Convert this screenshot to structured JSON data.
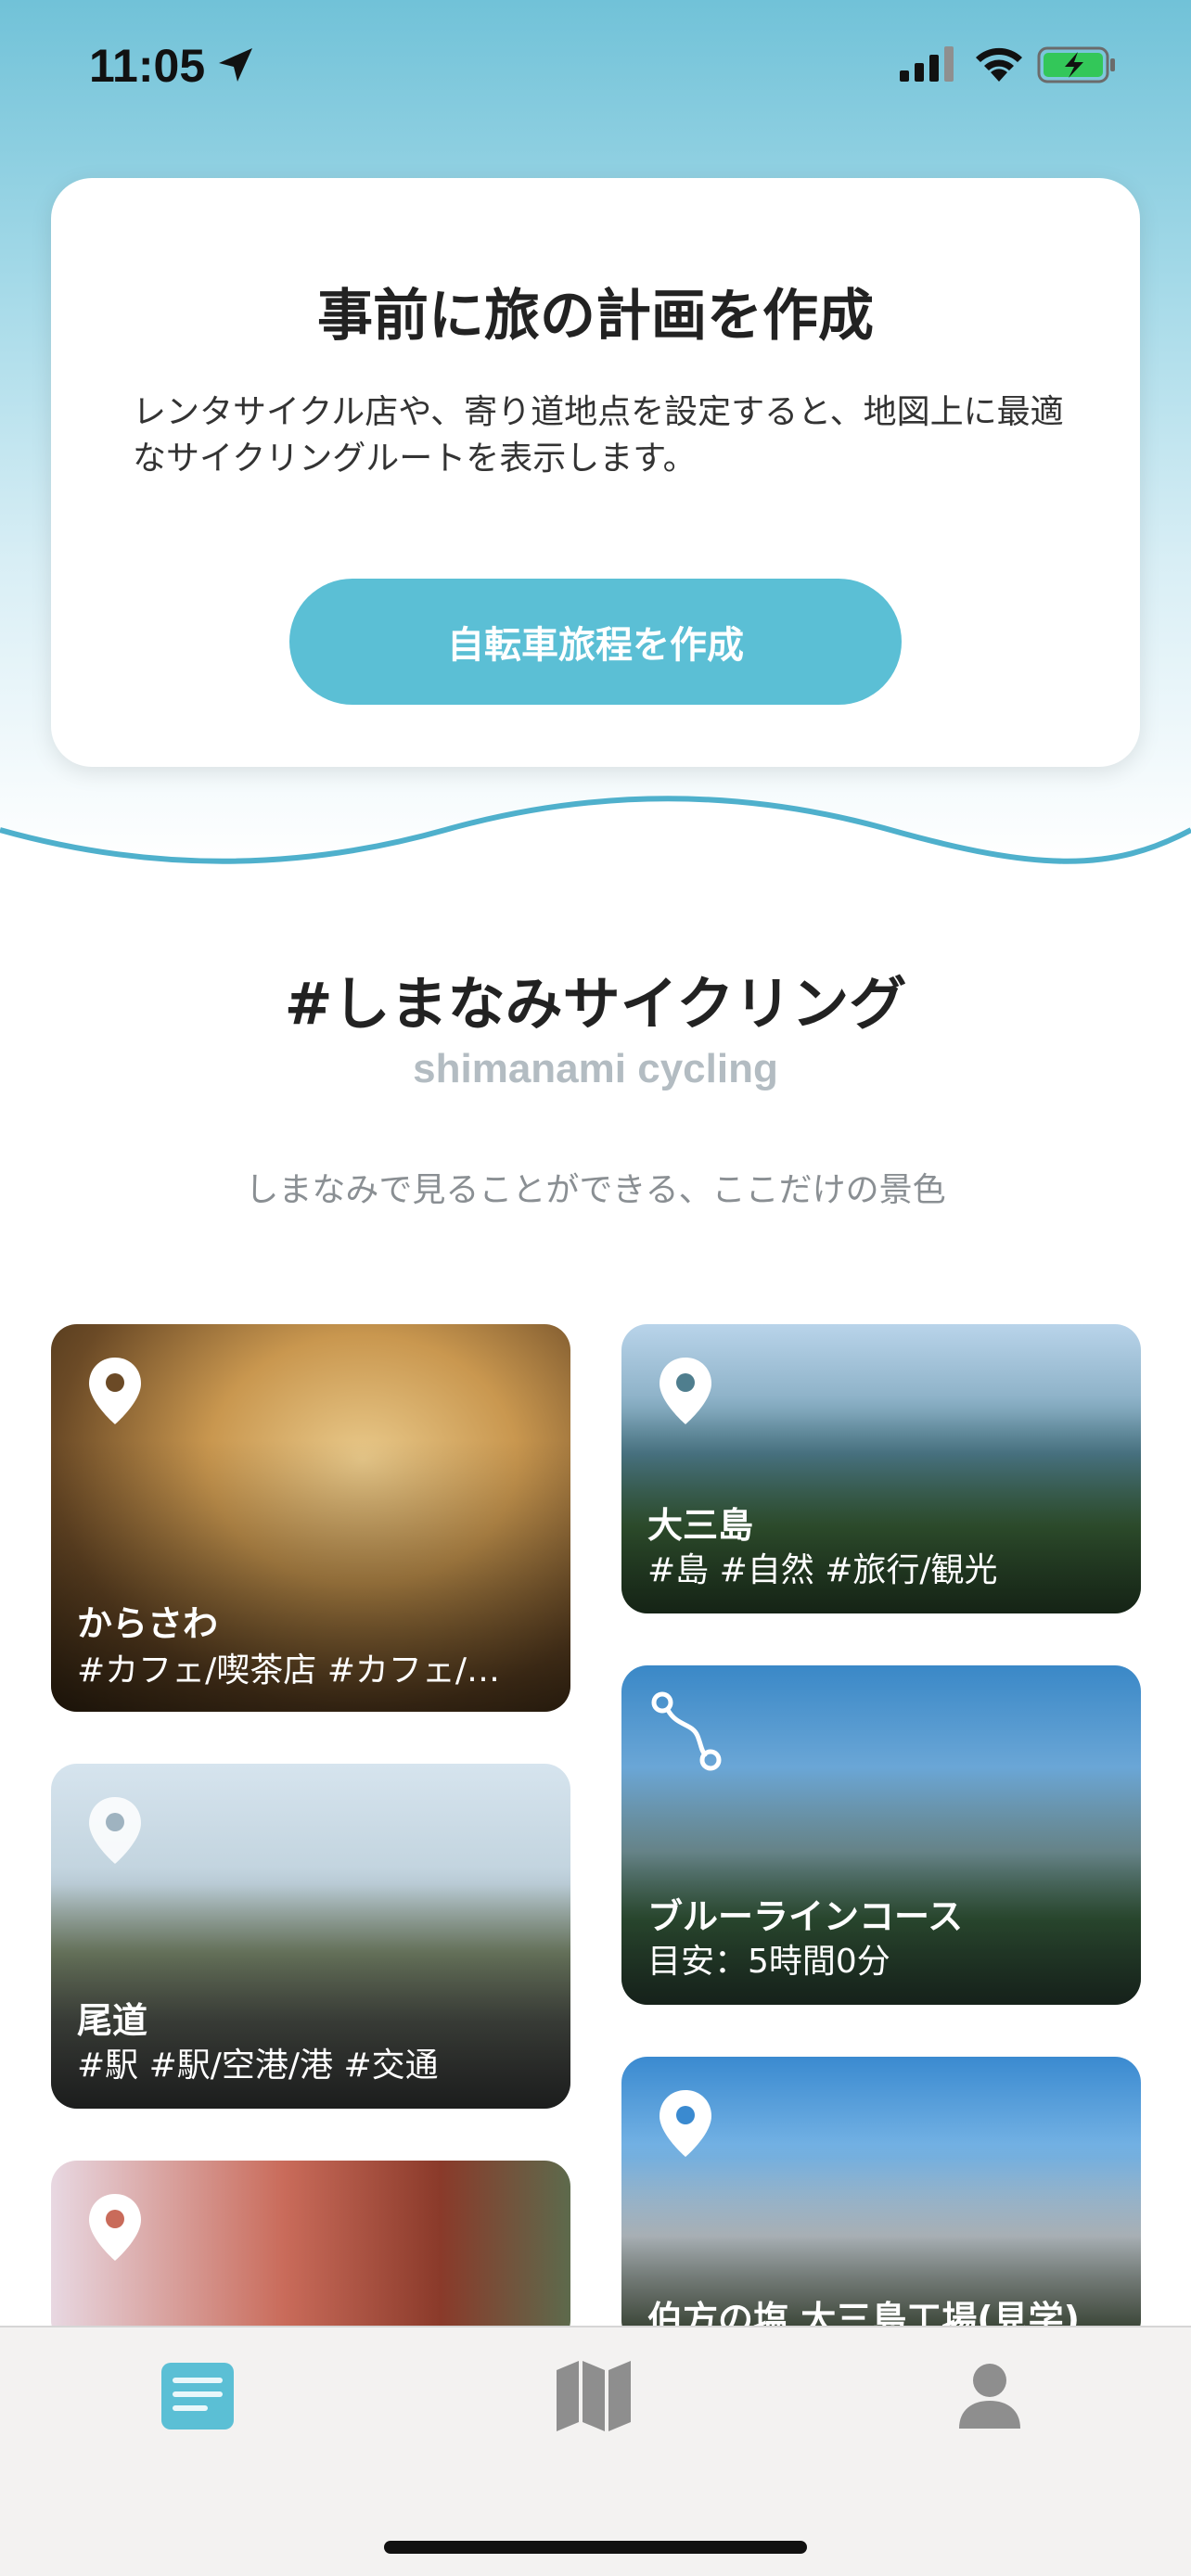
{
  "status_bar": {
    "time": "11:05"
  },
  "plan_card": {
    "title": "事前に旅の計画を作成",
    "description": "レンタサイクル店や、寄り道地点を設定すると、地図上に最適なサイクリングルートを表示します。",
    "button_label": "自転車旅程を作成"
  },
  "section": {
    "title": "#しまなみサイクリング",
    "subtitle": "shimanami cycling",
    "description": "しまなみで見ることができる、ここだけの景色"
  },
  "tiles": [
    {
      "title": "からさわ",
      "subtitle": "#カフェ/喫茶店 #カフェ/…",
      "icon": "location-pin-icon"
    },
    {
      "title": "大三島",
      "subtitle": "#島 #自然 #旅行/観光",
      "icon": "location-pin-icon"
    },
    {
      "title": "尾道",
      "subtitle": "#駅 #駅/空港/港 #交通",
      "icon": "location-pin-icon"
    },
    {
      "title": "ブルーラインコース",
      "subtitle": "目安：5時間0分",
      "icon": "route-icon"
    },
    {
      "title": "",
      "subtitle": "",
      "icon": "location-pin-icon"
    },
    {
      "title": "伯方の塩 大三島工場(見学)",
      "subtitle": "",
      "icon": "location-pin-icon"
    }
  ],
  "tab_bar": {
    "tabs": [
      {
        "icon": "news-icon",
        "active": true
      },
      {
        "icon": "map-icon",
        "active": false
      },
      {
        "icon": "profile-icon",
        "active": false
      }
    ]
  },
  "colors": {
    "accent": "#5bbfd5",
    "wave": "#4fb0cc",
    "tab_active": "#5bbfd5",
    "tab_inactive": "#8e8e8e"
  }
}
